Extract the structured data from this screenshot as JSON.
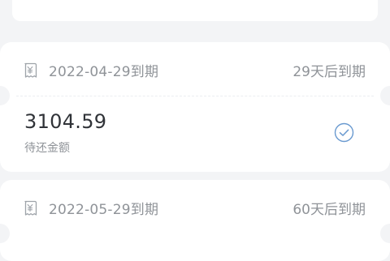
{
  "colors": {
    "background": "#f3f4f6",
    "card": "#ffffff",
    "primary_text": "#303338",
    "secondary_text": "#8f9398",
    "check_accent": "#6a9ad0"
  },
  "bills": [
    {
      "due_date": "2022-04-29到期",
      "days_left": "29天后到期",
      "amount": "3104.59",
      "amount_label": "待还金额",
      "status_icon": "check-circle-icon"
    },
    {
      "due_date": "2022-05-29到期",
      "days_left": "60天后到期",
      "calendar_icon": "bill-calendar-icon"
    }
  ]
}
